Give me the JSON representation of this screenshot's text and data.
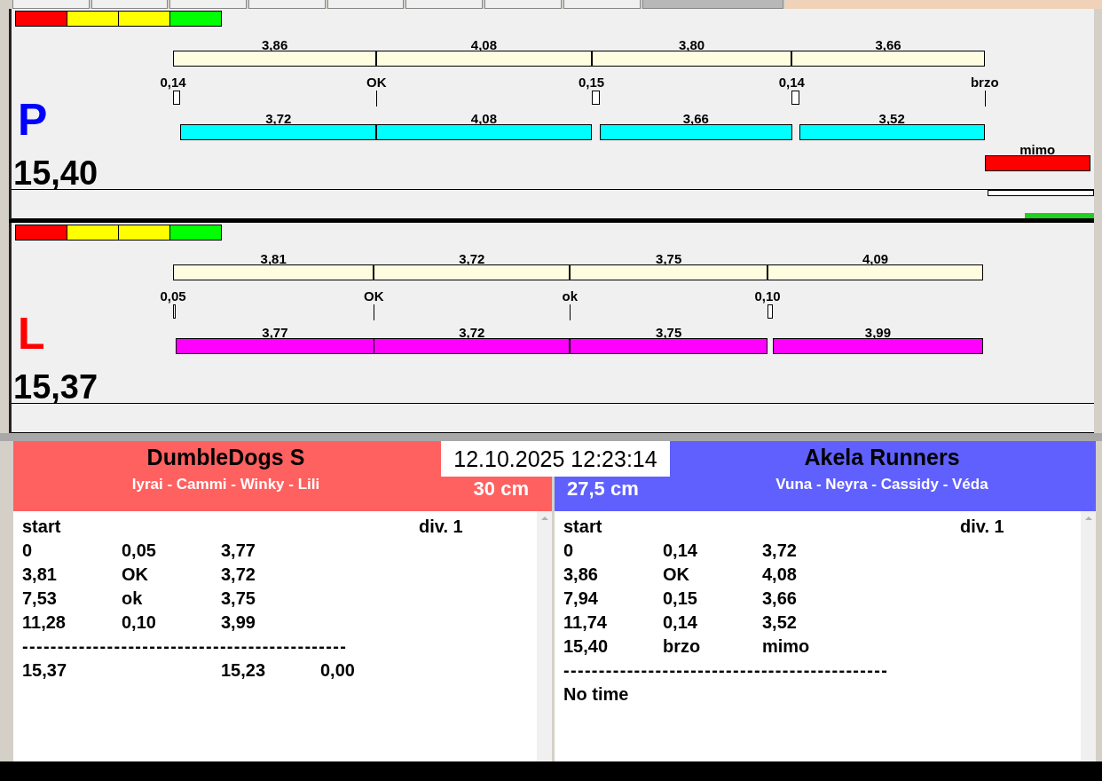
{
  "lanes": [
    {
      "letter": "P",
      "total": "15,40",
      "lights": [
        {
          "color": "#ff0000"
        },
        {
          "color": "#ffff00"
        },
        {
          "color": "#ffff00"
        },
        {
          "color": "#00ff00"
        }
      ],
      "color": "#00ffff",
      "finish_indicator": true,
      "top_segments": [
        "3,86",
        "4,08",
        "3,80",
        "3,66"
      ],
      "markers": [
        {
          "label": "0,14",
          "kind": "box"
        },
        {
          "label": "OK",
          "kind": "tick"
        },
        {
          "label": "0,15",
          "kind": "box"
        },
        {
          "label": "0,14",
          "kind": "box"
        },
        {
          "label": "brzo",
          "kind": "tick"
        }
      ],
      "bottom_segments": [
        "3,72",
        "4,08",
        "3,66",
        "3,52"
      ],
      "fault": {
        "label": "mimo",
        "color": "#ff0000"
      }
    },
    {
      "letter": "L",
      "total": "15,37",
      "lights": [
        {
          "color": "#ff0000"
        },
        {
          "color": "#ffff00"
        },
        {
          "color": "#ffff00"
        },
        {
          "color": "#00ff00"
        }
      ],
      "color": "#ff00ff",
      "finish_indicator": false,
      "top_segments": [
        "3,81",
        "3,72",
        "3,75",
        "4,09"
      ],
      "markers": [
        {
          "label": "0,05",
          "kind": "box"
        },
        {
          "label": "OK",
          "kind": "tick"
        },
        {
          "label": "ok",
          "kind": "tick"
        },
        {
          "label": "0,10",
          "kind": "box"
        }
      ],
      "bottom_segments": [
        "3,77",
        "3,72",
        "3,75",
        "3,99"
      ]
    }
  ],
  "datetime": "12.10.2025 12:23:14",
  "teams": [
    {
      "name": "DumbleDogs S",
      "dogs": "Iyrai - Cammi - Winky - Lili",
      "height": "30 cm",
      "color": "#ff6060",
      "start_label": "start",
      "division": "div.  1",
      "lines": [
        {
          "kind": "row",
          "cells": [
            "0",
            "0,05",
            "3,77"
          ]
        },
        {
          "kind": "row",
          "cells": [
            "3,81",
            "OK",
            "3,72"
          ]
        },
        {
          "kind": "row",
          "cells": [
            "7,53",
            "ok",
            "3,75"
          ]
        },
        {
          "kind": "row",
          "cells": [
            "11,28",
            "0,10",
            "3,99"
          ]
        },
        {
          "kind": "rule",
          "text": "----------------------------------------------"
        },
        {
          "kind": "summary",
          "first": "15,37",
          "rest": [
            "15,23",
            "0,00"
          ]
        }
      ]
    },
    {
      "name": "Akela Runners",
      "dogs": "Vuna - Neyra - Cassidy - Véda",
      "height": "27,5 cm",
      "color": "#6060ff",
      "start_label": "start",
      "division": "div.  1",
      "lines": [
        {
          "kind": "row",
          "cells": [
            "0",
            "0,14",
            "3,72"
          ]
        },
        {
          "kind": "row",
          "cells": [
            "3,86",
            "OK",
            "4,08"
          ]
        },
        {
          "kind": "row",
          "cells": [
            "7,94",
            "0,15",
            "3,66"
          ]
        },
        {
          "kind": "row",
          "cells": [
            "11,74",
            "0,14",
            "3,52"
          ]
        },
        {
          "kind": "row",
          "cells": [
            "15,40",
            "brzo",
            "mimo"
          ]
        },
        {
          "kind": "rule",
          "text": "----------------------------------------------"
        },
        {
          "kind": "note",
          "text": "No time"
        }
      ]
    }
  ]
}
